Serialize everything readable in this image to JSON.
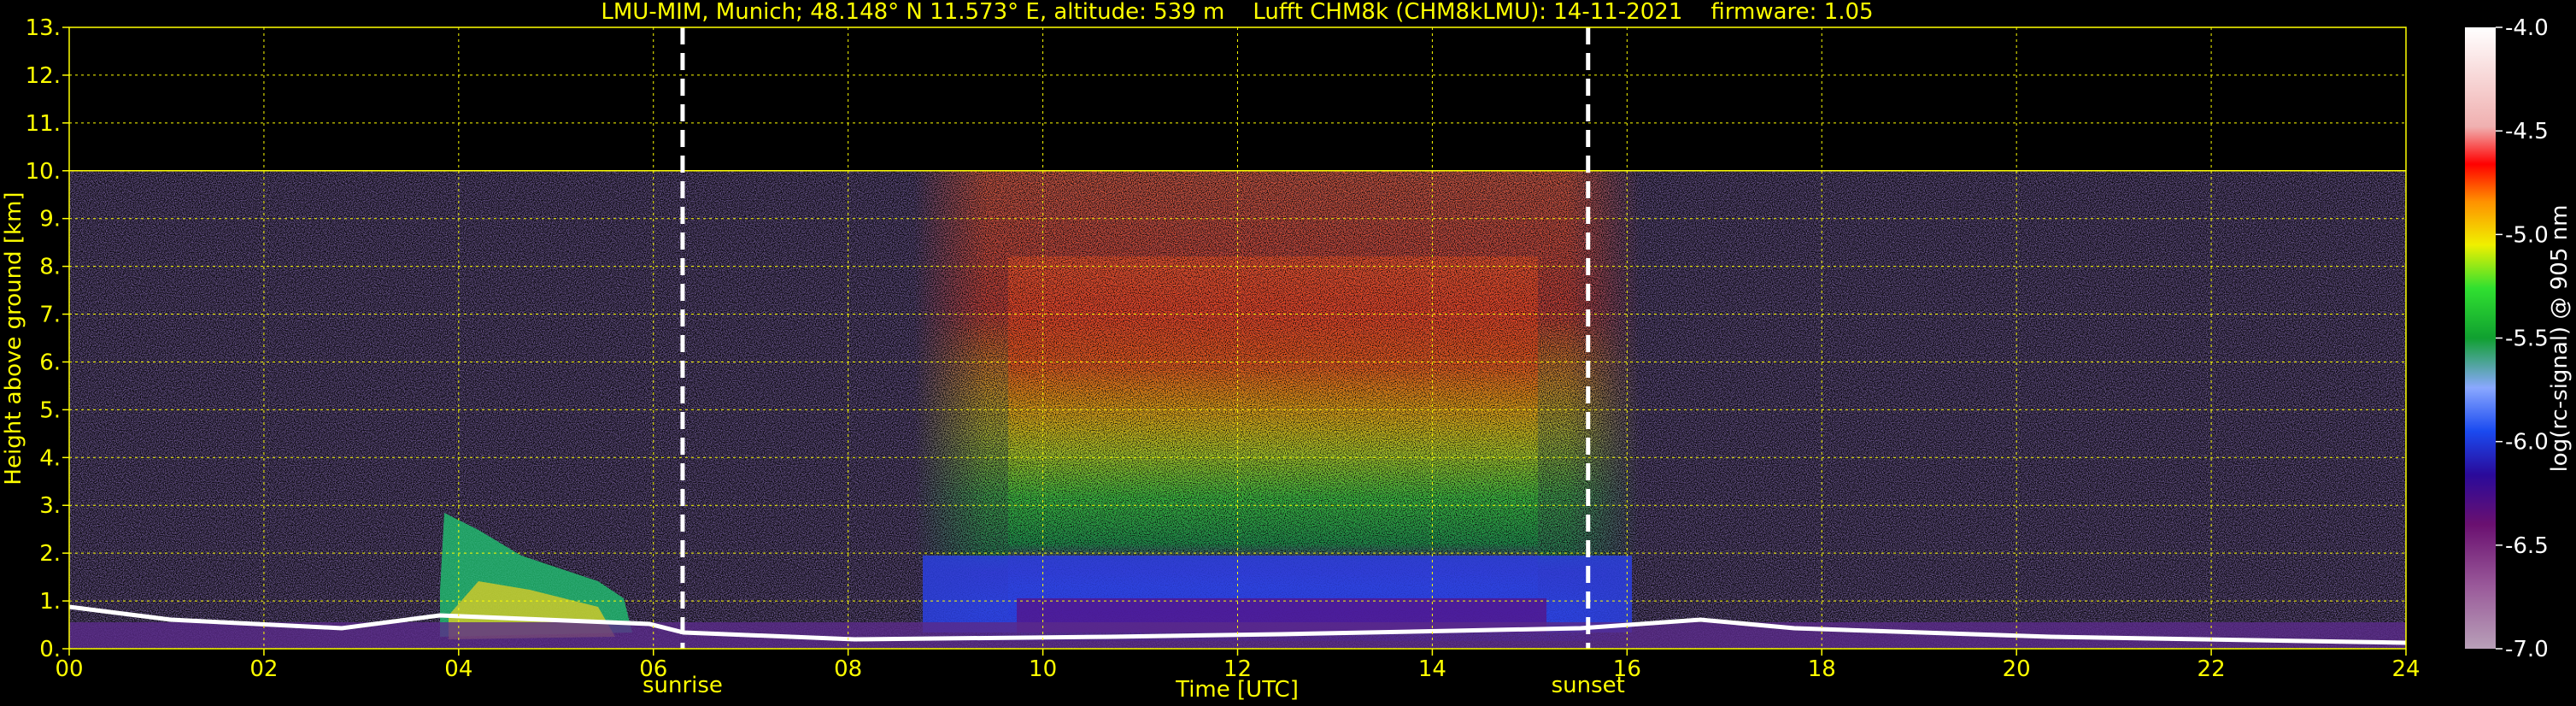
{
  "chart_data": {
    "type": "heatmap",
    "title": "LMU-MIM, Munich; 48.148° N 11.573° E, altitude: 539 m    Lufft CHM8k (CHM8kLMU): 14-11-2021    firmware: 1.05",
    "xlabel": "Time [UTC]",
    "ylabel": "Height above ground [km]",
    "xlim": [
      0,
      24
    ],
    "ylim": [
      0,
      13
    ],
    "x_ticks": [
      "00",
      "02",
      "04",
      "06",
      "08",
      "10",
      "12",
      "14",
      "16",
      "18",
      "20",
      "22",
      "24"
    ],
    "y_ticks": [
      "0.",
      "1.",
      "2.",
      "3.",
      "4.",
      "5.",
      "6.",
      "7.",
      "8.",
      "9.",
      "10.",
      "11.",
      "12.",
      "13."
    ],
    "grid": true,
    "measurement_top_km": 10,
    "colorbar": {
      "label": "log(rc-signal) @ 905 nm",
      "range": [
        -7.0,
        -4.0
      ],
      "ticks": [
        "-4.0",
        "-4.5",
        "-5.0",
        "-5.5",
        "-6.0",
        "-6.5",
        "-7.0"
      ]
    },
    "markers": [
      {
        "label": "sunrise",
        "time_h": 6.3
      },
      {
        "label": "sunset",
        "time_h": 15.6
      }
    ]
  },
  "colors": {
    "text": "#ffff00",
    "grid": "#ffff00",
    "background": "#000000",
    "marker_line": "#ffffff"
  }
}
